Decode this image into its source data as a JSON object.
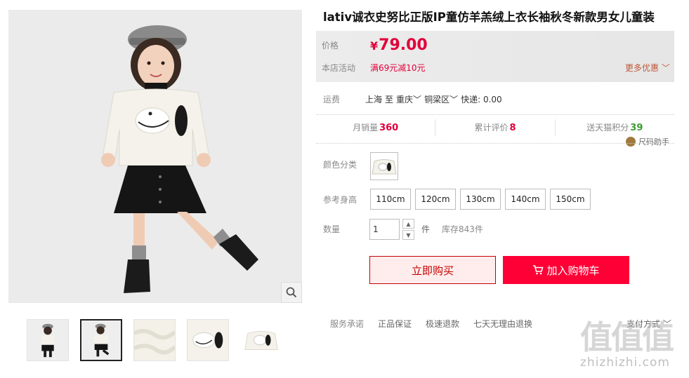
{
  "product": {
    "title": "lativ诚衣史努比正版IP童仿羊羔绒上衣长袖秋冬新款男女儿童装"
  },
  "price": {
    "label": "价格",
    "currency": "¥",
    "value": "79.00",
    "promo_label": "本店活动",
    "promo_text": "满69元减10元",
    "more_deals": "更多优惠"
  },
  "shipping": {
    "label": "运费",
    "from": "上海",
    "to_word": "至",
    "city": "重庆",
    "district": "铜梁区",
    "express": "快递: 0.00"
  },
  "stats": {
    "monthly_sales_label": "月销量",
    "monthly_sales": "360",
    "reviews_label": "累计评价",
    "reviews": "8",
    "points_label": "送天猫积分",
    "points": "39"
  },
  "size_helper": "尺码助手",
  "options": {
    "color_label": "颜色分类",
    "size_label": "参考身高",
    "sizes": [
      "110cm",
      "120cm",
      "130cm",
      "140cm",
      "150cm"
    ],
    "qty_label": "数量",
    "qty_value": "1",
    "unit": "件",
    "stock": "库存843件"
  },
  "actions": {
    "buy_now": "立即购买",
    "add_to_cart": "加入购物车"
  },
  "service": {
    "label": "服务承诺",
    "items": [
      "正品保证",
      "极速退款",
      "七天无理由退换"
    ],
    "payment": "支付方式"
  },
  "watermark": {
    "chars": "值值值",
    "url": "zhizhizhi.com"
  },
  "colors": {
    "accent": "#ff0036",
    "price": "#e1003a",
    "points": "#3a9b2f"
  }
}
